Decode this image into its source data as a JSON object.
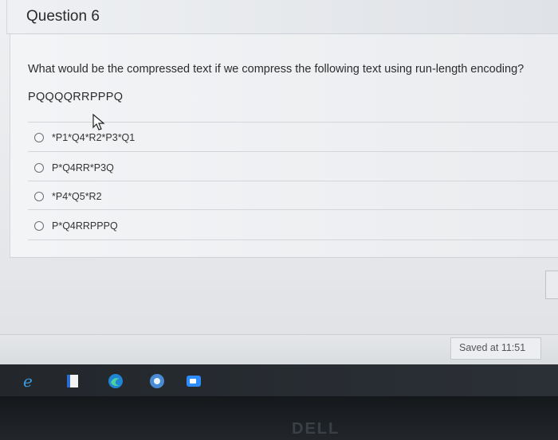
{
  "question": {
    "title": "Question 6",
    "prompt": "What would be the compressed text if we compress the following text using run-length encoding?",
    "input_text": "PQQQQRRPPPQ",
    "options": [
      {
        "label": "*P1*Q4*R2*P3*Q1"
      },
      {
        "label": "P*Q4RR*P3Q"
      },
      {
        "label": "*P4*Q5*R2"
      },
      {
        "label": "P*Q4RRPPPQ"
      }
    ],
    "selected_option": null
  },
  "footer": {
    "saved_text": "Saved at 11:51"
  },
  "taskbar": {
    "icons": [
      "internet-explorer-icon",
      "file-icon",
      "edge-icon",
      "chrome-icon",
      "zoom-icon"
    ]
  },
  "bezel": {
    "brand": "DELL"
  },
  "colors": {
    "page_bg": "#eef0f2",
    "taskbar": "#23272c",
    "edge_blue": "#1f86d6"
  }
}
